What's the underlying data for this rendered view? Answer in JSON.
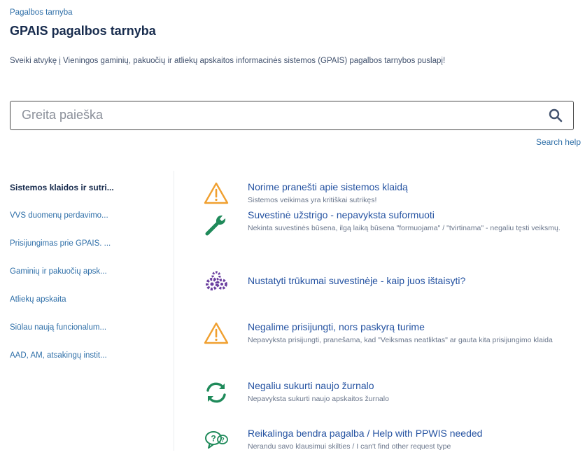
{
  "header": {
    "breadcrumb": "Pagalbos tarnyba",
    "title": "GPAIS pagalbos tarnyba",
    "welcome": "Sveiki atvykę į Vieningos gaminių, pakuočių ir atliekų apskaitos informacinės sistemos (GPAIS) pagalbos tarnybos puslapį!"
  },
  "search": {
    "placeholder": "Greita paieška",
    "help_link": "Search help"
  },
  "sidebar": {
    "items": [
      {
        "label": "Sistemos klaidos ir sutri...",
        "active": true
      },
      {
        "label": "VVS duomenų perdavimo...",
        "active": false
      },
      {
        "label": "Prisijungimas prie GPAIS. ...",
        "active": false
      },
      {
        "label": "Gaminių ir pakuočių apsk...",
        "active": false
      },
      {
        "label": "Atliekų apskaita",
        "active": false
      },
      {
        "label": "Siūlau naują funcionalum...",
        "active": false
      },
      {
        "label": "AAD, AM, atsakingų instit...",
        "active": false
      }
    ]
  },
  "requests": [
    {
      "icon": "warning-icon",
      "title": "Norime pranešti apie sistemos klaidą",
      "description": "Sistemos veikimas yra kritiškai sutrikęs!"
    },
    {
      "icon": "wrench-icon",
      "title": "Suvestinė užstrigo - nepavyksta suformuoti",
      "description": "Nekinta suvestinės būsena, ilgą laiką būsena \"formuojama\" / \"tvirtinama\" - negaliu tęsti veiksmų."
    },
    {
      "icon": "gears-icon",
      "title": "Nustatyti trūkumai suvestinėje - kaip juos ištaisyti?",
      "description": ""
    },
    {
      "icon": "warning-icon",
      "title": "Negalime prisijungti, nors paskyrą turime",
      "description": "Nepavyksta prisijungti, pranešama, kad \"Veiksmas neatliktas\" ar gauta kita prisijungimo klaida"
    },
    {
      "icon": "refresh-icon",
      "title": "Negaliu sukurti naujo žurnalo",
      "description": "Nepavyksta sukurti naujo apskaitos žurnalo"
    },
    {
      "icon": "question-bubble-icon",
      "title": "Reikalinga bendra pagalba / Help with PPWIS needed",
      "description": "Nerandu savo klausimui skilties / I can't find other request type"
    }
  ],
  "colors": {
    "link": "#2452a1",
    "warning": "#f0a030",
    "wrench": "#1f8a5a",
    "gears": "#6b3fa0",
    "refresh": "#1f8a5a"
  }
}
